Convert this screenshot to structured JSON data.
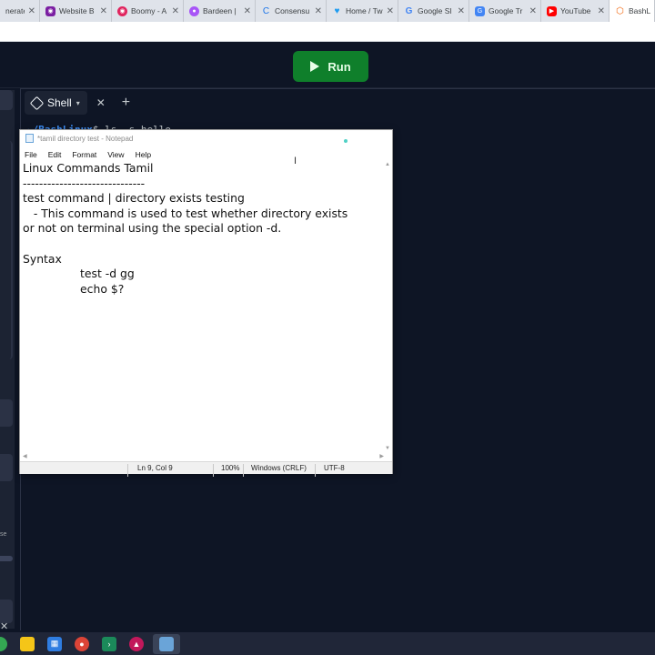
{
  "browser": {
    "tabs": [
      {
        "label": "nerate",
        "icon": "generator-icon",
        "color": "#5f6368"
      },
      {
        "label": "Website B",
        "icon": "website-icon",
        "color": "#7b1fa2"
      },
      {
        "label": "Boomy - A",
        "icon": "boomy-icon",
        "color": "#e0245e"
      },
      {
        "label": "Bardeen |",
        "icon": "bardeen-icon",
        "color": "#a855f7"
      },
      {
        "label": "Consensu",
        "icon": "consensus-icon",
        "color": "#1a73e8"
      },
      {
        "label": "Home / Tw",
        "icon": "twitter-icon",
        "color": "#1d9bf0"
      },
      {
        "label": "Google Sl",
        "icon": "google-icon",
        "color": "#4285f4"
      },
      {
        "label": "Google Tr",
        "icon": "google-translate-icon",
        "color": "#4285f4"
      },
      {
        "label": "YouTube",
        "icon": "youtube-icon",
        "color": "#ff0000"
      },
      {
        "label": "BashLin",
        "icon": "replit-icon",
        "color": "#f26207"
      }
    ]
  },
  "replit": {
    "run_label": "Run",
    "shell_tab_label": "Shell",
    "prompt_dir": "~/BashLinux",
    "prompt_cmd": "$ ls -s hello",
    "left_partial_text": "se"
  },
  "notepad": {
    "title": "*tamil directory test - Notepad",
    "menu": [
      "File",
      "Edit",
      "Format",
      "View",
      "Help"
    ],
    "content": "Linux Commands Tamil\n------------------------------\ntest command | directory exists testing\n   - This command is used to test whether directory exists\nor not on terminal using the special option -d.\n\nSyntax\n\t\ttest -d gg\n\t\techo $?",
    "status": {
      "position": "Ln 9, Col 9",
      "zoom": "100%",
      "line_ending": "Windows (CRLF)",
      "encoding": "UTF-8"
    }
  },
  "taskbar": {
    "icons": [
      "chrome-partial-icon",
      "file-explorer-icon",
      "microsoft-store-icon",
      "chrome-icon",
      "terminal-icon",
      "media-icon",
      "notepad-icon"
    ]
  }
}
